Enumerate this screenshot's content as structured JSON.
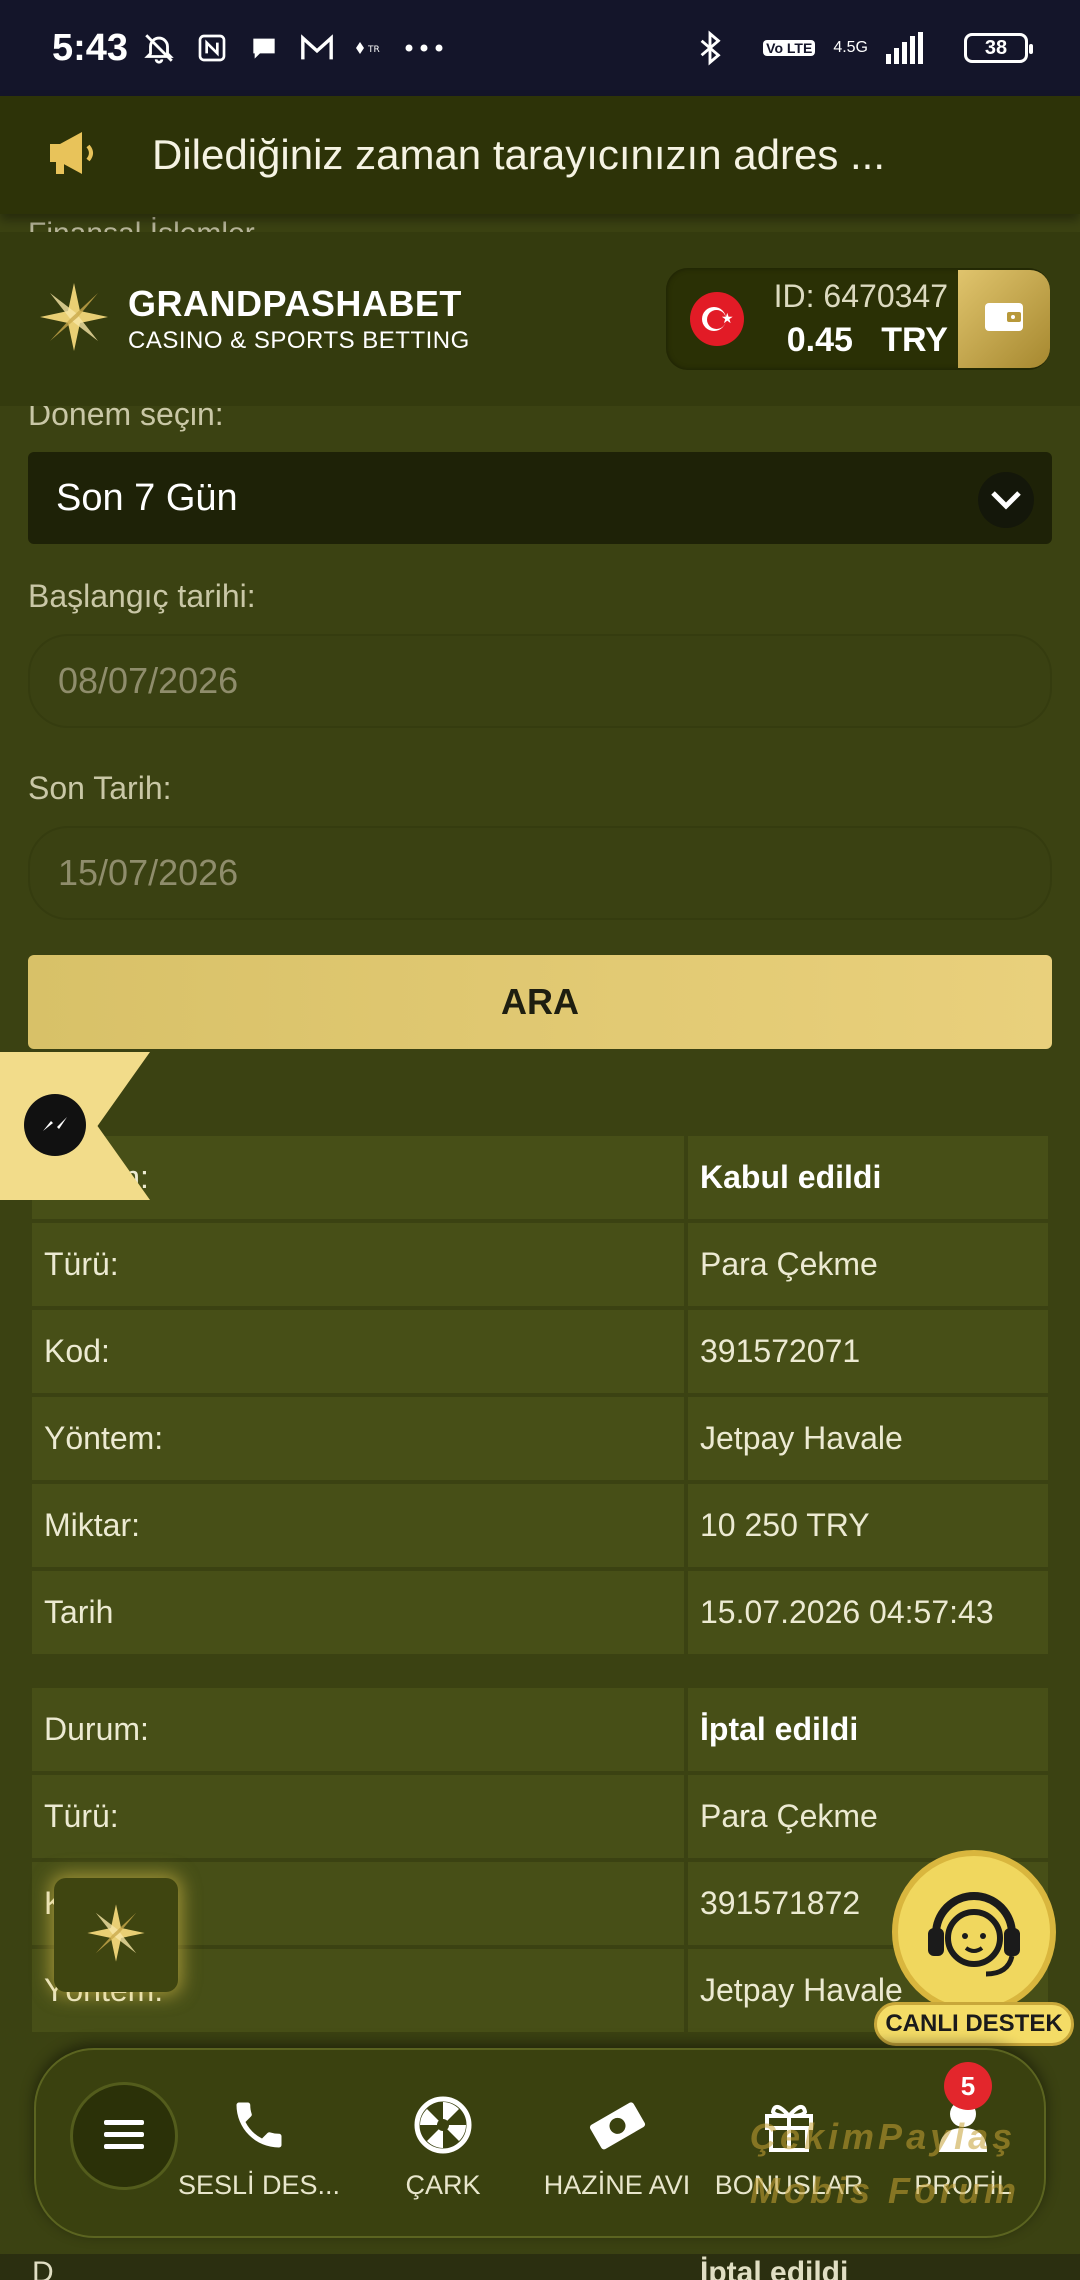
{
  "status_bar": {
    "time": "5:43",
    "network": "4.5G",
    "volte": "Vo LTE",
    "battery": "38"
  },
  "announcement": {
    "text": "Dilediğiniz zaman tarayıcınızın adres ..."
  },
  "partial_label": "Finansal İşlemler",
  "header": {
    "brand": "GRANDPASHABET",
    "tagline": "CASINO & SPORTS BETTING",
    "account_id": "ID: 6470347",
    "balance": "0.45",
    "currency": "TRY"
  },
  "filters": {
    "period_label": "Dönem seçin:",
    "period_value": "Son 7 Gün",
    "start_label": "Başlangıç tarihi:",
    "start_value": "08/07/2026",
    "end_label": "Son Tarih:",
    "end_value": "15/07/2026",
    "search_button": "ARA"
  },
  "transactions": [
    {
      "rows": [
        {
          "key": "Durum:",
          "value": "Kabul edildi"
        },
        {
          "key": "Türü:",
          "value": "Para Çekme"
        },
        {
          "key": "Kod:",
          "value": "391572071"
        },
        {
          "key": "Yöntem:",
          "value": "Jetpay Havale"
        },
        {
          "key": "Miktar:",
          "value": "10 250 TRY"
        },
        {
          "key": "Tarih",
          "value": "15.07.2026 04:57:43"
        }
      ]
    },
    {
      "rows": [
        {
          "key": "Durum:",
          "value": "İptal edildi"
        },
        {
          "key": "Türü:",
          "value": "Para Çekme"
        },
        {
          "key": "Kod:",
          "value": "391571872"
        },
        {
          "key": "Yöntem:",
          "value": "Jetpay Havale"
        }
      ]
    }
  ],
  "partial_bottom": {
    "key": "D",
    "value": "İptal edildi"
  },
  "live_support": "CANLI DESTEK",
  "bottom_nav": {
    "items": [
      {
        "label": "SESLİ DES...",
        "icon": "phone-icon"
      },
      {
        "label": "ÇARK",
        "icon": "wheel-icon"
      },
      {
        "label": "HAZİNE AVI",
        "icon": "money-icon"
      },
      {
        "label": "BONUSLAR",
        "icon": "gift-icon"
      },
      {
        "label": "PROFİL",
        "icon": "profile-icon"
      }
    ],
    "profile_badge": "5"
  },
  "watermark": "ÇekimPaylaş Mobis Forum",
  "colors": {
    "background": "#3b4212",
    "accent_gold": "#e0c46d",
    "table_cell": "#474f17",
    "badge_red": "#e3262c"
  }
}
